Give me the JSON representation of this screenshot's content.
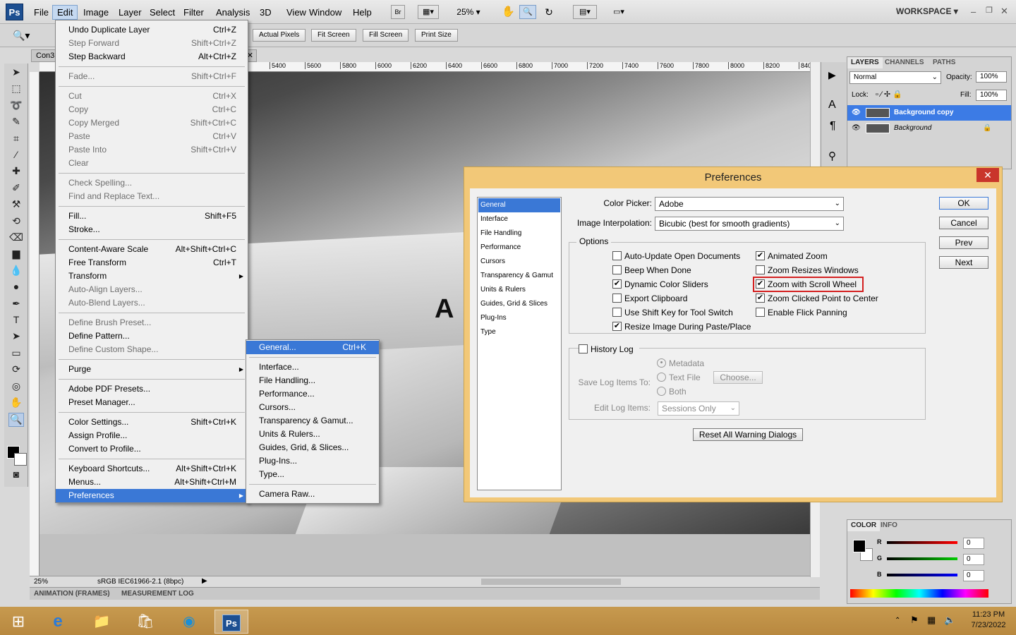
{
  "app": {
    "logo": "Ps",
    "workspace": "WORKSPACE",
    "zoom_combo": "25%"
  },
  "menubar": [
    "File",
    "Edit",
    "Image",
    "Layer",
    "Select",
    "Filter",
    "Analysis",
    "3D",
    "View",
    "Window",
    "Help"
  ],
  "options_bar": {
    "buttons": [
      "Actual Pixels",
      "Fit Screen",
      "Fill Screen",
      "Print Size"
    ]
  },
  "document": {
    "tab": "Con3",
    "ruler_ticks": [
      "5400",
      "5600",
      "5800",
      "6000",
      "6200",
      "6400",
      "6600",
      "6800",
      "7000",
      "7200",
      "7400",
      "7600",
      "7800",
      "8000",
      "8200",
      "840"
    ],
    "status_zoom": "25%",
    "status_profile": "sRGB IEC61966-2.1 (8bpc)",
    "bottom_tabs": [
      "ANIMATION (FRAMES)",
      "MEASUREMENT LOG"
    ]
  },
  "edit_menu": [
    {
      "label": "Undo Duplicate Layer",
      "shortcut": "Ctrl+Z",
      "disabled": false
    },
    {
      "label": "Step Forward",
      "shortcut": "Shift+Ctrl+Z",
      "disabled": true
    },
    {
      "label": "Step Backward",
      "shortcut": "Alt+Ctrl+Z",
      "disabled": false
    },
    {
      "sep": true
    },
    {
      "label": "Fade...",
      "shortcut": "Shift+Ctrl+F",
      "disabled": true
    },
    {
      "sep": true
    },
    {
      "label": "Cut",
      "shortcut": "Ctrl+X",
      "disabled": true
    },
    {
      "label": "Copy",
      "shortcut": "Ctrl+C",
      "disabled": true
    },
    {
      "label": "Copy Merged",
      "shortcut": "Shift+Ctrl+C",
      "disabled": true
    },
    {
      "label": "Paste",
      "shortcut": "Ctrl+V",
      "disabled": true
    },
    {
      "label": "Paste Into",
      "shortcut": "Shift+Ctrl+V",
      "disabled": true
    },
    {
      "label": "Clear",
      "shortcut": "",
      "disabled": true
    },
    {
      "sep": true
    },
    {
      "label": "Check Spelling...",
      "shortcut": "",
      "disabled": true
    },
    {
      "label": "Find and Replace Text...",
      "shortcut": "",
      "disabled": true
    },
    {
      "sep": true
    },
    {
      "label": "Fill...",
      "shortcut": "Shift+F5",
      "disabled": false
    },
    {
      "label": "Stroke...",
      "shortcut": "",
      "disabled": false
    },
    {
      "sep": true
    },
    {
      "label": "Content-Aware Scale",
      "shortcut": "Alt+Shift+Ctrl+C",
      "disabled": false
    },
    {
      "label": "Free Transform",
      "shortcut": "Ctrl+T",
      "disabled": false
    },
    {
      "label": "Transform",
      "shortcut": "",
      "disabled": false,
      "submenu": true
    },
    {
      "label": "Auto-Align Layers...",
      "shortcut": "",
      "disabled": true
    },
    {
      "label": "Auto-Blend Layers...",
      "shortcut": "",
      "disabled": true
    },
    {
      "sep": true
    },
    {
      "label": "Define Brush Preset...",
      "shortcut": "",
      "disabled": true
    },
    {
      "label": "Define Pattern...",
      "shortcut": "",
      "disabled": false
    },
    {
      "label": "Define Custom Shape...",
      "shortcut": "",
      "disabled": true
    },
    {
      "sep": true
    },
    {
      "label": "Purge",
      "shortcut": "",
      "disabled": false,
      "submenu": true
    },
    {
      "sep": true
    },
    {
      "label": "Adobe PDF Presets...",
      "shortcut": "",
      "disabled": false
    },
    {
      "label": "Preset Manager...",
      "shortcut": "",
      "disabled": false
    },
    {
      "sep": true
    },
    {
      "label": "Color Settings...",
      "shortcut": "Shift+Ctrl+K",
      "disabled": false
    },
    {
      "label": "Assign Profile...",
      "shortcut": "",
      "disabled": false
    },
    {
      "label": "Convert to Profile...",
      "shortcut": "",
      "disabled": false
    },
    {
      "sep": true
    },
    {
      "label": "Keyboard Shortcuts...",
      "shortcut": "Alt+Shift+Ctrl+K",
      "disabled": false
    },
    {
      "label": "Menus...",
      "shortcut": "Alt+Shift+Ctrl+M",
      "disabled": false
    },
    {
      "label": "Preferences",
      "shortcut": "",
      "disabled": false,
      "submenu": true,
      "highlight": true
    }
  ],
  "pref_submenu": [
    {
      "label": "General...",
      "shortcut": "Ctrl+K",
      "highlight": true
    },
    {
      "sep": true
    },
    {
      "label": "Interface..."
    },
    {
      "label": "File Handling..."
    },
    {
      "label": "Performance..."
    },
    {
      "label": "Cursors..."
    },
    {
      "label": "Transparency & Gamut..."
    },
    {
      "label": "Units & Rulers..."
    },
    {
      "label": "Guides, Grid, & Slices..."
    },
    {
      "label": "Plug-Ins..."
    },
    {
      "label": "Type..."
    },
    {
      "sep": true
    },
    {
      "label": "Camera Raw..."
    }
  ],
  "preferences": {
    "title": "Preferences",
    "close": "✕",
    "categories": [
      "General",
      "Interface",
      "File Handling",
      "Performance",
      "Cursors",
      "Transparency & Gamut",
      "Units & Rulers",
      "Guides, Grid & Slices",
      "Plug-Ins",
      "Type"
    ],
    "color_picker_label": "Color Picker:",
    "color_picker_value": "Adobe",
    "interp_label": "Image Interpolation:",
    "interp_value": "Bicubic (best for smooth gradients)",
    "options_legend": "Options",
    "options_left": [
      {
        "label": "Auto-Update Open Documents",
        "checked": false
      },
      {
        "label": "Beep When Done",
        "checked": false
      },
      {
        "label": "Dynamic Color Sliders",
        "checked": true
      },
      {
        "label": "Export Clipboard",
        "checked": false
      },
      {
        "label": "Use Shift Key for Tool Switch",
        "checked": false
      },
      {
        "label": "Resize Image During Paste/Place",
        "checked": true
      }
    ],
    "options_right": [
      {
        "label": "Animated Zoom",
        "checked": true
      },
      {
        "label": "Zoom Resizes Windows",
        "checked": false
      },
      {
        "label": "Zoom with Scroll Wheel",
        "checked": true,
        "outlined": true
      },
      {
        "label": "Zoom Clicked Point to Center",
        "checked": true
      },
      {
        "label": "Enable Flick Panning",
        "checked": false
      }
    ],
    "history_log": "History Log",
    "save_log_label": "Save Log Items To:",
    "radio_metadata": "Metadata",
    "radio_textfile": "Text File",
    "radio_both": "Both",
    "choose_btn": "Choose...",
    "edit_log_label": "Edit Log Items:",
    "edit_log_value": "Sessions Only",
    "reset_btn": "Reset All Warning Dialogs",
    "buttons": [
      "OK",
      "Cancel",
      "Prev",
      "Next"
    ]
  },
  "layers_panel": {
    "tabs": [
      "LAYERS",
      "CHANNELS",
      "PATHS"
    ],
    "blend": "Normal",
    "opacity_label": "Opacity:",
    "opacity": "100%",
    "lock_label": "Lock:",
    "fill_label": "Fill:",
    "fill": "100%",
    "layers": [
      "Background copy",
      "Background"
    ]
  },
  "color_panel": {
    "tabs": [
      "COLOR",
      "INFO"
    ],
    "r_label": "R",
    "g_label": "G",
    "b_label": "B",
    "r": "0",
    "g": "0",
    "b": "0"
  },
  "taskbar": {
    "time": "11:23 PM",
    "date": "7/23/2022"
  }
}
